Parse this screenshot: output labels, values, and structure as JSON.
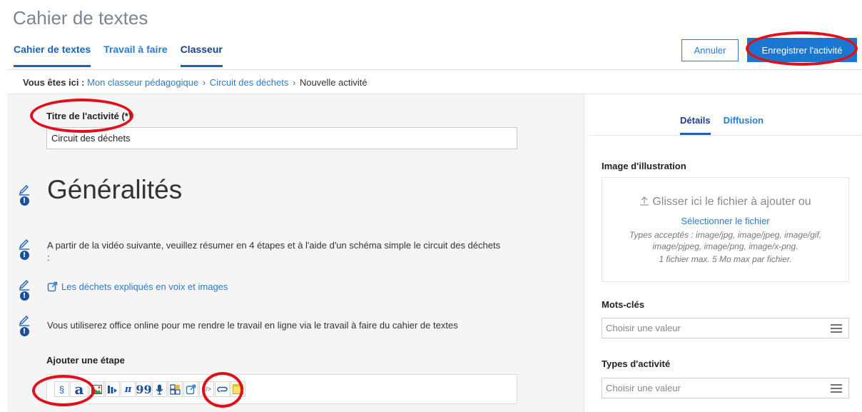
{
  "app": {
    "title": "Cahier de textes"
  },
  "nav": {
    "tabs": [
      {
        "label": "Cahier de textes"
      },
      {
        "label": "Travail à faire"
      },
      {
        "label": "Classeur"
      }
    ]
  },
  "actions": {
    "cancel_label": "Annuler",
    "save_label": "Enregistrer l'activité"
  },
  "breadcrumb": {
    "prefix": "Vous êtes ici :",
    "items": [
      {
        "label": "Mon classeur pédagogique"
      },
      {
        "label": "Circuit des déchets"
      },
      {
        "label": "Nouvelle activité"
      }
    ],
    "separator": "›"
  },
  "form": {
    "title_label": "Titre de l'activité (*)",
    "title_value": "Circuit des déchets"
  },
  "content": {
    "heading": "Généralités",
    "paragraph1": "A partir de la vidéo suivante, veuillez résumer en 4 étapes et à l'aide d'un schéma simple le circuit des déchets :",
    "link_text": "Les déchets expliqués en voix et images",
    "paragraph2": "Vous utiliserez office online pour me rendre le travail en ligne via le travail à faire du cahier de textes",
    "add_step_label": "Ajouter une étape"
  },
  "toolbar": {
    "section_glyph": "§",
    "text_glyph": "a",
    "pi_glyph": "π",
    "quote_glyph": "99",
    "code_glyph": "</>"
  },
  "right_panel": {
    "tabs": [
      {
        "label": "Détails"
      },
      {
        "label": "Diffusion"
      }
    ],
    "image_label": "Image d'illustration",
    "drop_title": "Glisser ici le fichier à ajouter ou",
    "drop_link": "Sélectionner le fichier",
    "drop_info1": "Types acceptés : image/jpg, image/jpeg, image/gif, image/pjpeg, image/png, image/x-png.",
    "drop_info2": "1 fichier max. 5 Mo max par fichier.",
    "keywords_label": "Mots-clés",
    "keywords_placeholder": "Choisir une valeur",
    "types_label": "Types d'activité",
    "types_placeholder": "Choisir une valeur"
  },
  "colors": {
    "accent": "#1976d2",
    "link": "#2b7bd1",
    "highlight": "#e0101a"
  }
}
